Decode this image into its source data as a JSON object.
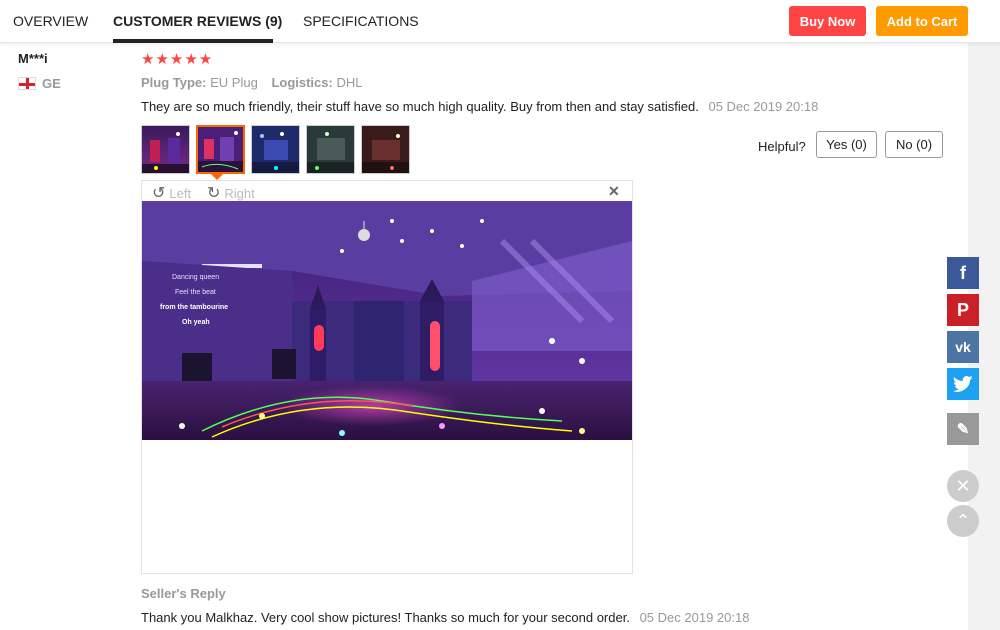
{
  "tabs": [
    {
      "label": "OVERVIEW"
    },
    {
      "label": "CUSTOMER REVIEWS (9)"
    },
    {
      "label": "SPECIFICATIONS"
    }
  ],
  "actions": {
    "buy_now": "Buy Now",
    "add_to_cart": "Add to Cart"
  },
  "reviewer": {
    "name": "M***i",
    "country": "GE"
  },
  "review": {
    "rating": 5,
    "stars": "★★★★★",
    "plug_type_label": "Plug Type:",
    "plug_type_value": "EU Plug",
    "logistics_label": "Logistics:",
    "logistics_value": "DHL",
    "text": "They are so much friendly, their stuff have so much high quality. Buy from then and stay satisfied.",
    "date": "05 Dec 2019 20:18"
  },
  "helpful": {
    "label": "Helpful?",
    "yes": "Yes (0)",
    "no": "No (0)"
  },
  "viewer": {
    "rotate_left": "Left",
    "rotate_right": "Right",
    "overlay_lines": [
      "Dancing queen",
      "Feel the beat",
      "from the tambourine",
      "Oh yeah"
    ]
  },
  "seller_reply": {
    "label": "Seller's Reply",
    "text": "Thank you Malkhaz. Very cool show pictures! Thanks so much for your second order.",
    "date": "05 Dec 2019 20:18"
  },
  "social": {
    "facebook_color": "#3b5998",
    "pinterest_color": "#cb2027",
    "vk_color": "#4c75a3",
    "twitter_color": "#1da1f2",
    "edit_color": "#999999"
  },
  "colors": {
    "buy": "#ff4444",
    "cart": "#ff9a00",
    "star": "#ff4444"
  }
}
